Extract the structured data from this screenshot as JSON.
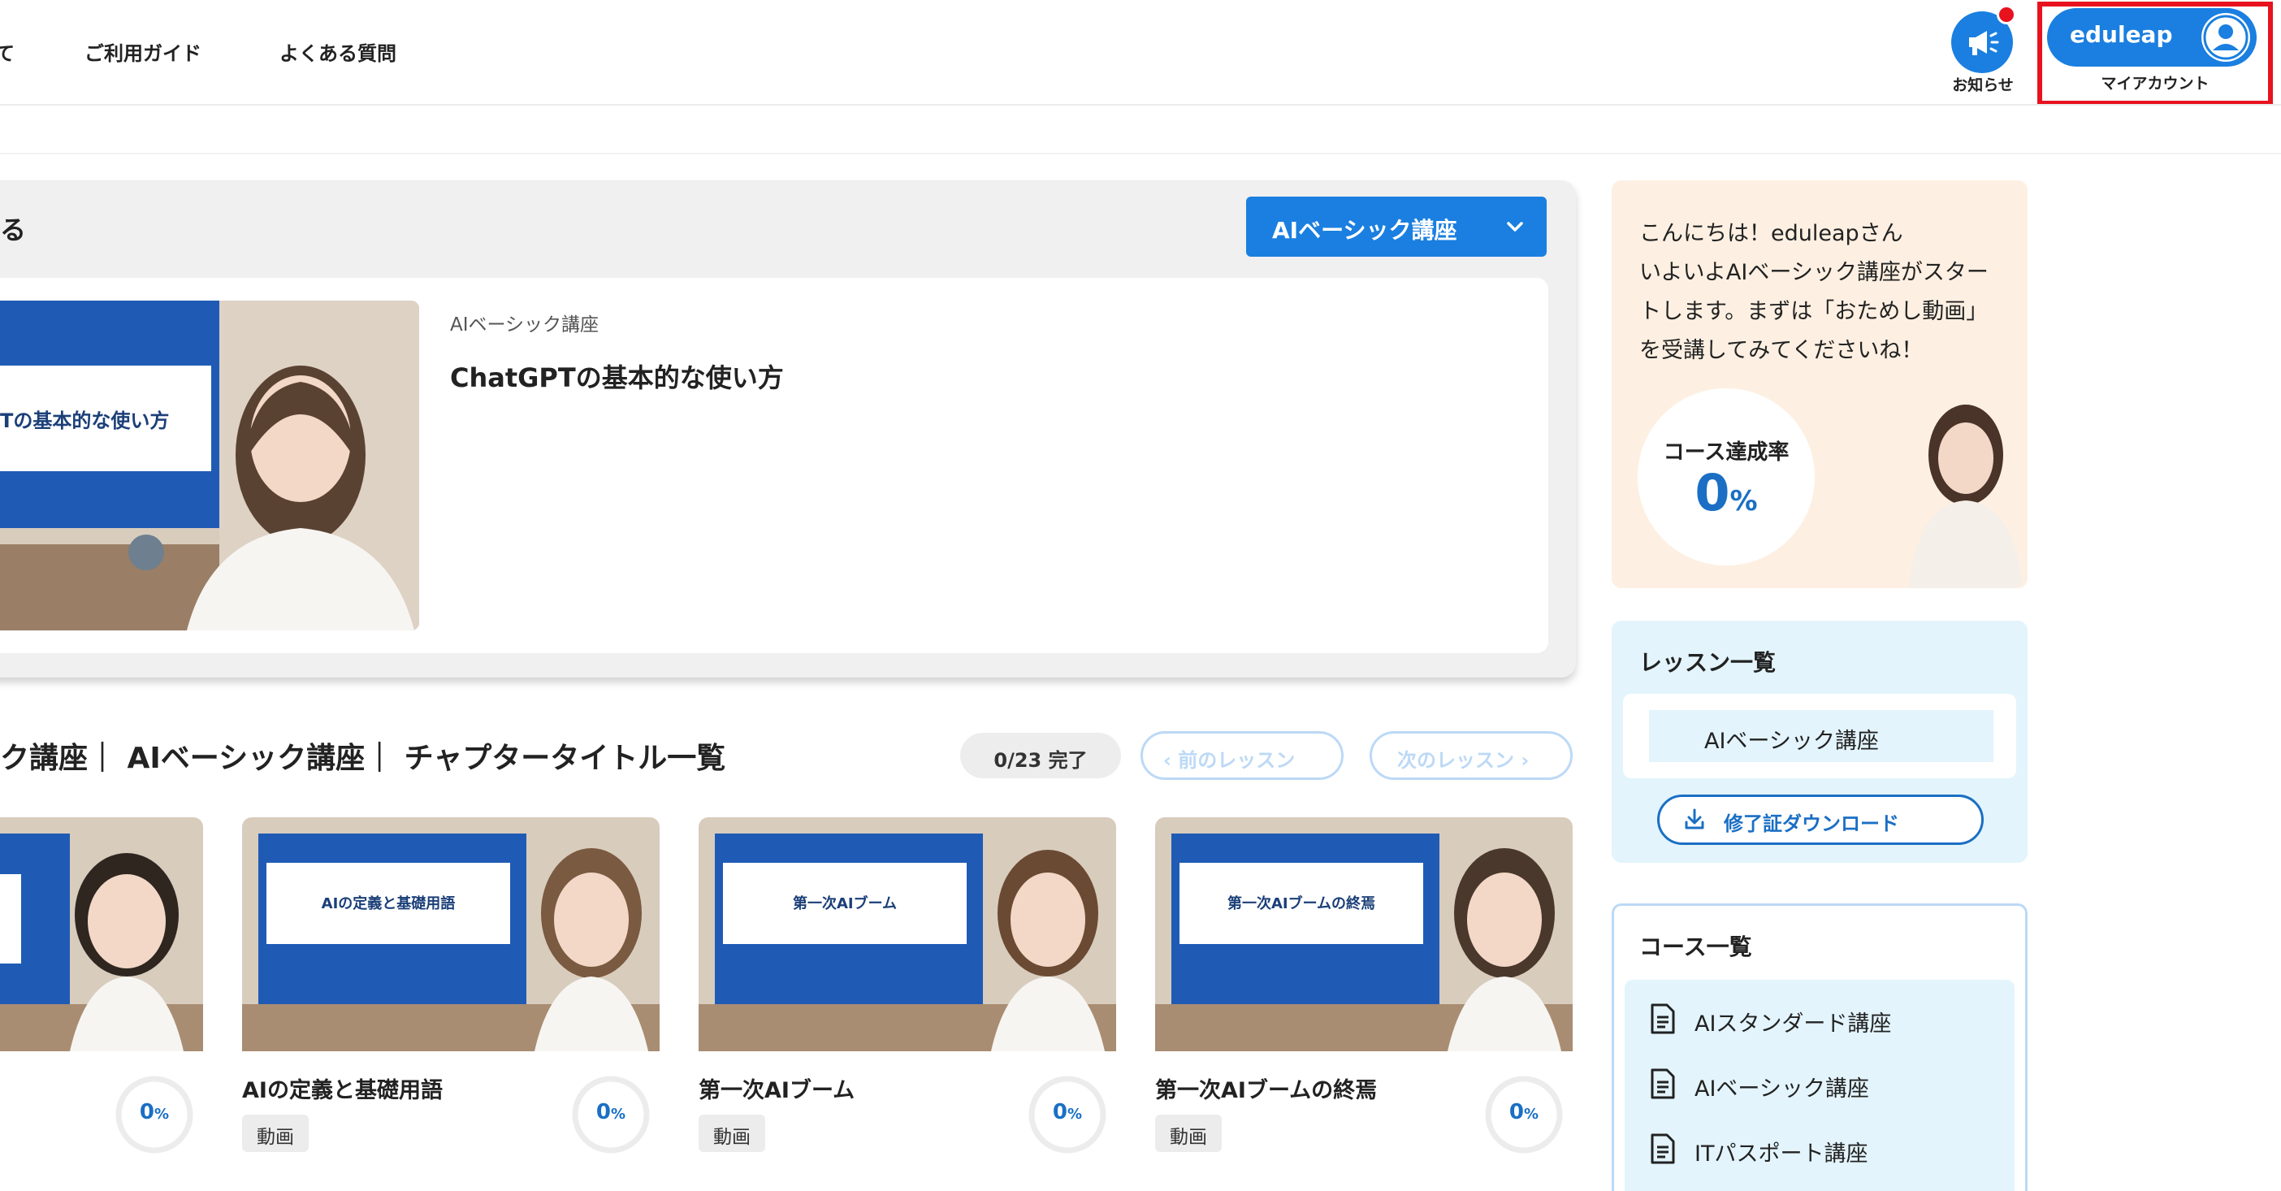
{
  "header": {
    "nav_fragment": "て",
    "nav_guide": "ご利用ガイド",
    "nav_faq": "よくある質問",
    "notice_label": "お知らせ",
    "account_name": "eduleap",
    "account_label": "マイアカウント"
  },
  "current": {
    "title_fragment": "る",
    "course_select": "AIベーシック講座",
    "thumb_text": "Tの基本的な使い方",
    "lesson_course": "AIベーシック講座",
    "lesson_title": "ChatGPTの基本的な使い方"
  },
  "chapters": {
    "heading": "ク講座｜ AIベーシック講座｜ チャプタータイトル一覧",
    "progress": "0/23 完了",
    "prev": "‹ 前のレッスン",
    "next": "次のレッスン ›",
    "cards": [
      {
        "title": "",
        "thumb_text": "",
        "tag": "",
        "percent": "0"
      },
      {
        "title": "AIの定義と基礎用語",
        "thumb_text": "AIの定義と基礎用語",
        "tag": "動画",
        "percent": "0"
      },
      {
        "title": "第一次AIブーム",
        "thumb_text": "第一次AIブーム",
        "tag": "動画",
        "percent": "0"
      },
      {
        "title": "第一次AIブームの終焉",
        "thumb_text": "第一次AIブームの終焉",
        "tag": "動画",
        "percent": "0"
      }
    ],
    "percent_unit": "%"
  },
  "sidebar": {
    "greeting": [
      "こんにちは！eduleapさん",
      "いよいよAIベーシック講座がスター",
      "トします。まずは「おためし動画」",
      "を受講してみてくださいね！"
    ],
    "rate_label": "コース達成率",
    "rate_value": "0",
    "rate_unit": "%",
    "lessons_title": "レッスン一覧",
    "lessons_item": "AIベーシック講座",
    "cert_button": "修了証ダウンロード",
    "courses_title": "コース一覧",
    "courses": [
      "AIスタンダード講座",
      "AIベーシック講座",
      "ITパスポート講座"
    ]
  },
  "colors": {
    "accent": "#1a7fe0",
    "highlight": "#e8121f",
    "percent": "#1a6fc4"
  }
}
